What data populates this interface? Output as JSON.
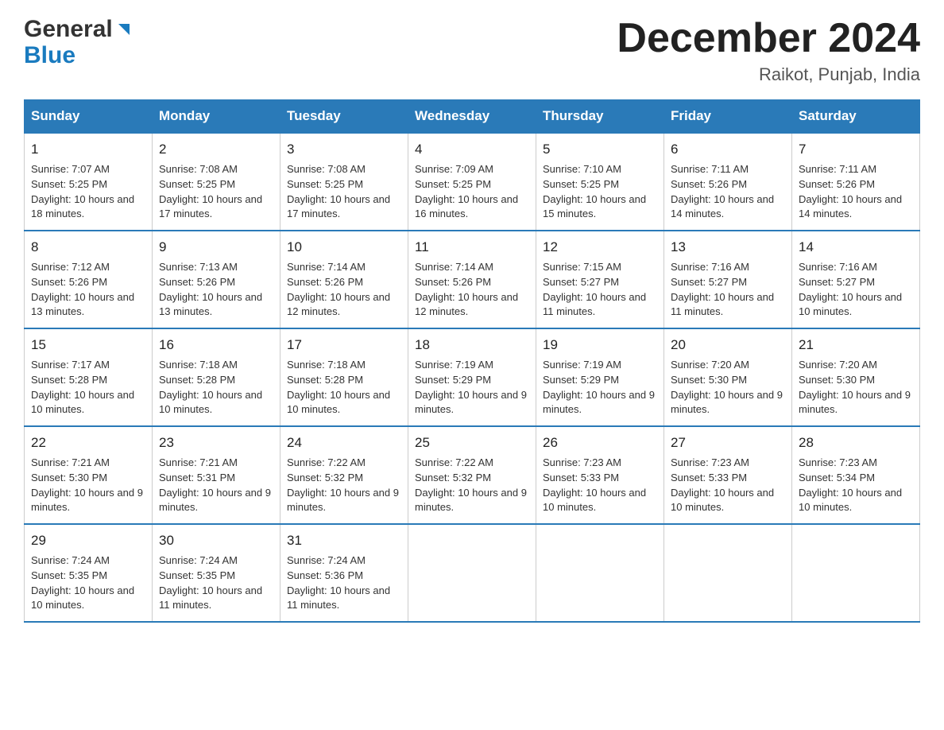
{
  "header": {
    "logo_general": "General",
    "logo_blue": "Blue",
    "month_title": "December 2024",
    "location": "Raikot, Punjab, India"
  },
  "days_of_week": [
    "Sunday",
    "Monday",
    "Tuesday",
    "Wednesday",
    "Thursday",
    "Friday",
    "Saturday"
  ],
  "weeks": [
    [
      {
        "day": "1",
        "sunrise": "7:07 AM",
        "sunset": "5:25 PM",
        "daylight": "10 hours and 18 minutes."
      },
      {
        "day": "2",
        "sunrise": "7:08 AM",
        "sunset": "5:25 PM",
        "daylight": "10 hours and 17 minutes."
      },
      {
        "day": "3",
        "sunrise": "7:08 AM",
        "sunset": "5:25 PM",
        "daylight": "10 hours and 17 minutes."
      },
      {
        "day": "4",
        "sunrise": "7:09 AM",
        "sunset": "5:25 PM",
        "daylight": "10 hours and 16 minutes."
      },
      {
        "day": "5",
        "sunrise": "7:10 AM",
        "sunset": "5:25 PM",
        "daylight": "10 hours and 15 minutes."
      },
      {
        "day": "6",
        "sunrise": "7:11 AM",
        "sunset": "5:26 PM",
        "daylight": "10 hours and 14 minutes."
      },
      {
        "day": "7",
        "sunrise": "7:11 AM",
        "sunset": "5:26 PM",
        "daylight": "10 hours and 14 minutes."
      }
    ],
    [
      {
        "day": "8",
        "sunrise": "7:12 AM",
        "sunset": "5:26 PM",
        "daylight": "10 hours and 13 minutes."
      },
      {
        "day": "9",
        "sunrise": "7:13 AM",
        "sunset": "5:26 PM",
        "daylight": "10 hours and 13 minutes."
      },
      {
        "day": "10",
        "sunrise": "7:14 AM",
        "sunset": "5:26 PM",
        "daylight": "10 hours and 12 minutes."
      },
      {
        "day": "11",
        "sunrise": "7:14 AM",
        "sunset": "5:26 PM",
        "daylight": "10 hours and 12 minutes."
      },
      {
        "day": "12",
        "sunrise": "7:15 AM",
        "sunset": "5:27 PM",
        "daylight": "10 hours and 11 minutes."
      },
      {
        "day": "13",
        "sunrise": "7:16 AM",
        "sunset": "5:27 PM",
        "daylight": "10 hours and 11 minutes."
      },
      {
        "day": "14",
        "sunrise": "7:16 AM",
        "sunset": "5:27 PM",
        "daylight": "10 hours and 10 minutes."
      }
    ],
    [
      {
        "day": "15",
        "sunrise": "7:17 AM",
        "sunset": "5:28 PM",
        "daylight": "10 hours and 10 minutes."
      },
      {
        "day": "16",
        "sunrise": "7:18 AM",
        "sunset": "5:28 PM",
        "daylight": "10 hours and 10 minutes."
      },
      {
        "day": "17",
        "sunrise": "7:18 AM",
        "sunset": "5:28 PM",
        "daylight": "10 hours and 10 minutes."
      },
      {
        "day": "18",
        "sunrise": "7:19 AM",
        "sunset": "5:29 PM",
        "daylight": "10 hours and 9 minutes."
      },
      {
        "day": "19",
        "sunrise": "7:19 AM",
        "sunset": "5:29 PM",
        "daylight": "10 hours and 9 minutes."
      },
      {
        "day": "20",
        "sunrise": "7:20 AM",
        "sunset": "5:30 PM",
        "daylight": "10 hours and 9 minutes."
      },
      {
        "day": "21",
        "sunrise": "7:20 AM",
        "sunset": "5:30 PM",
        "daylight": "10 hours and 9 minutes."
      }
    ],
    [
      {
        "day": "22",
        "sunrise": "7:21 AM",
        "sunset": "5:30 PM",
        "daylight": "10 hours and 9 minutes."
      },
      {
        "day": "23",
        "sunrise": "7:21 AM",
        "sunset": "5:31 PM",
        "daylight": "10 hours and 9 minutes."
      },
      {
        "day": "24",
        "sunrise": "7:22 AM",
        "sunset": "5:32 PM",
        "daylight": "10 hours and 9 minutes."
      },
      {
        "day": "25",
        "sunrise": "7:22 AM",
        "sunset": "5:32 PM",
        "daylight": "10 hours and 9 minutes."
      },
      {
        "day": "26",
        "sunrise": "7:23 AM",
        "sunset": "5:33 PM",
        "daylight": "10 hours and 10 minutes."
      },
      {
        "day": "27",
        "sunrise": "7:23 AM",
        "sunset": "5:33 PM",
        "daylight": "10 hours and 10 minutes."
      },
      {
        "day": "28",
        "sunrise": "7:23 AM",
        "sunset": "5:34 PM",
        "daylight": "10 hours and 10 minutes."
      }
    ],
    [
      {
        "day": "29",
        "sunrise": "7:24 AM",
        "sunset": "5:35 PM",
        "daylight": "10 hours and 10 minutes."
      },
      {
        "day": "30",
        "sunrise": "7:24 AM",
        "sunset": "5:35 PM",
        "daylight": "10 hours and 11 minutes."
      },
      {
        "day": "31",
        "sunrise": "7:24 AM",
        "sunset": "5:36 PM",
        "daylight": "10 hours and 11 minutes."
      },
      null,
      null,
      null,
      null
    ]
  ],
  "sunrise_label": "Sunrise: ",
  "sunset_label": "Sunset: ",
  "daylight_label": "Daylight: "
}
